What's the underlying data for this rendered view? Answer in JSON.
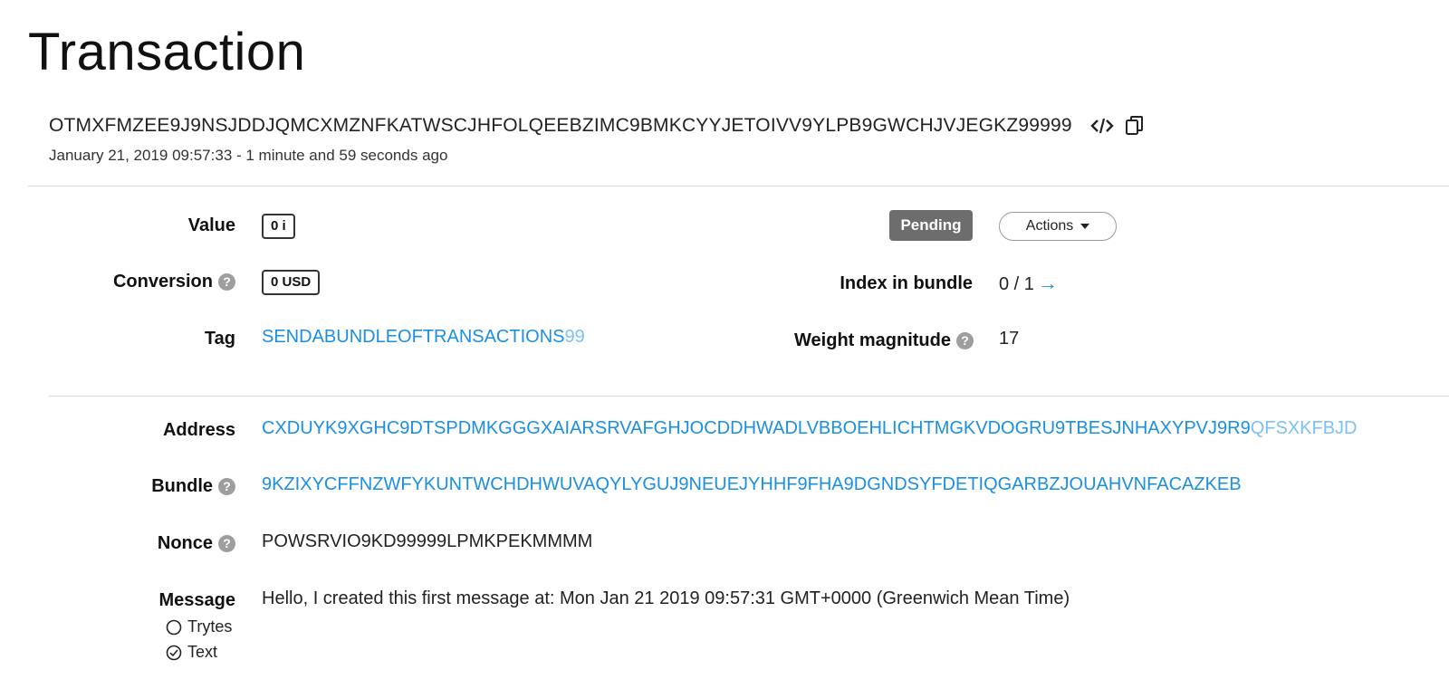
{
  "page": {
    "title": "Transaction"
  },
  "transaction": {
    "hash": "OTMXFMZEE9J9NSJDDJQMCXMZNFKATWSCJHFOLQEEBZIMC9BMKCYYJETOIVV9YLPB9GWCHJVJEGKZ99999",
    "timestamp": "January 21, 2019 09:57:33 - 1 minute and 59 seconds ago"
  },
  "icons": {
    "code": "code-icon",
    "copy": "copy-icon",
    "help": "help-circle-icon",
    "arrow": "arrow-right-icon"
  },
  "labels": {
    "value": "Value",
    "conversion": "Conversion",
    "tag": "Tag",
    "index_in_bundle": "Index in bundle",
    "weight_magnitude": "Weight magnitude",
    "address": "Address",
    "bundle": "Bundle",
    "nonce": "Nonce",
    "message": "Message"
  },
  "help_glyph": "?",
  "fields": {
    "value": "0 i",
    "conversion": "0 USD",
    "tag_main": "SENDABUNDLEOFTRANSACTIONS",
    "tag_suffix": "99",
    "status": "Pending",
    "actions_label": "Actions",
    "index_in_bundle": "0 / 1",
    "arrow_glyph": "→",
    "weight_magnitude": "17",
    "address_main": "CXDUYK9XGHC9DTSPDMKGGGXAIARSRVAFGHJOCDDHWADLVBBOEHLICHTMGKVDOGRU9TBESJNHAXYPVJ9R9",
    "address_checksum": "QFSXKFBJD",
    "bundle": "9KZIXYCFFNZWFYKUNTWCHDHWUVAQYLYGUJ9NEUEJYHHF9FHA9DGNDSYFDETIQGARBZJOUAHVNFACAZKEB",
    "nonce": "POWSRVIO9KD99999LPMKPEKMMMM",
    "message": "Hello, I created this first message at: Mon Jan 21 2019 09:57:31 GMT+0000 (Greenwich Mean Time)"
  },
  "message_format": {
    "options": [
      "Trytes",
      "Text"
    ],
    "selected": "Text"
  },
  "colors": {
    "link": "#1a8fe3",
    "link_faded": "#7cc1f2",
    "pending_bg": "#6d6d6d"
  }
}
